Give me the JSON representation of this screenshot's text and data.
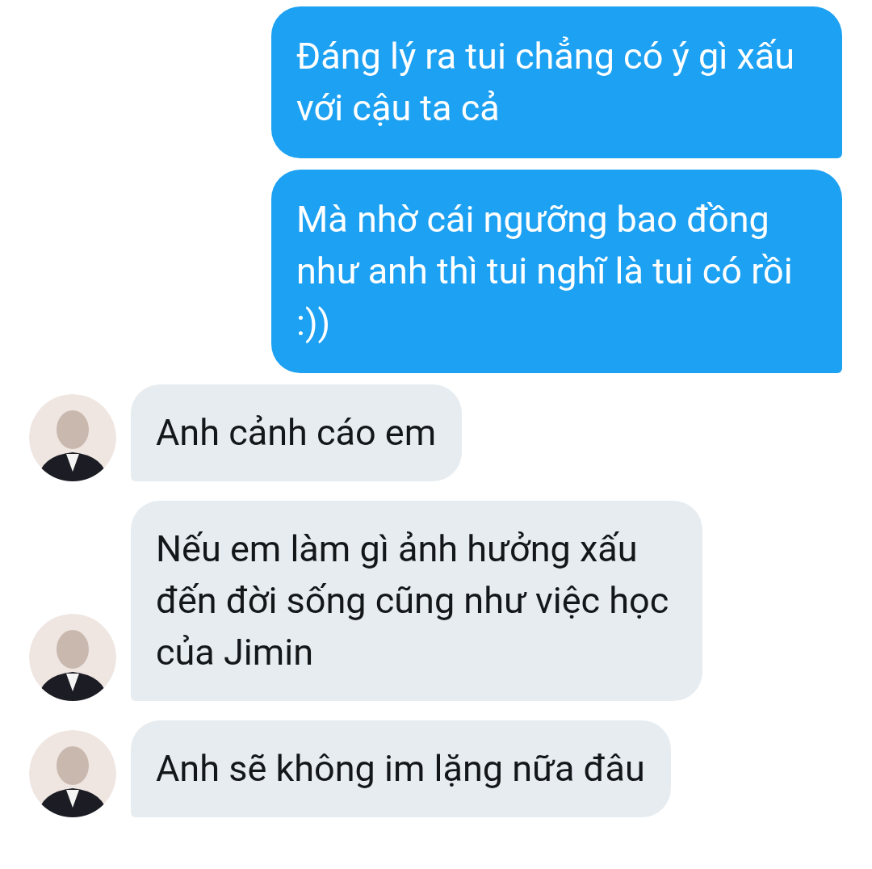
{
  "messages": [
    {
      "kind": "sent",
      "text": "Đáng lý ra tui chẳng có ý gì xấu với cậu ta cả"
    },
    {
      "kind": "sent",
      "text": "Mà nhờ cái ngưỡng bao đồng như anh thì tui nghĩ là tui có rồi :))"
    },
    {
      "kind": "received",
      "text": "Anh cảnh cáo em"
    },
    {
      "kind": "received",
      "text": "Nếu em làm gì ảnh hưởng xấu đến đời sống cũng như việc học của Jimin"
    },
    {
      "kind": "received",
      "text": "Anh sẽ không im lặng nữa đâu"
    }
  ]
}
